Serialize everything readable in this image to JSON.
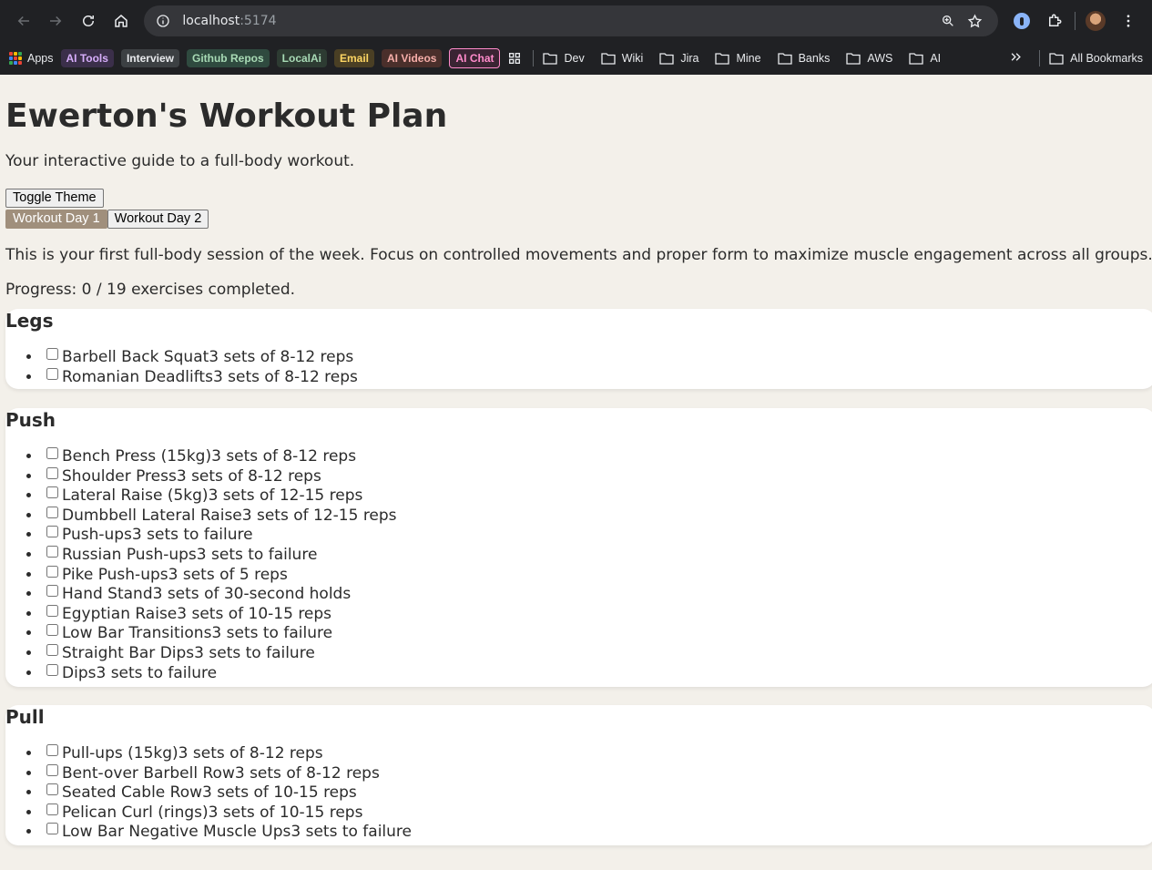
{
  "browser": {
    "url_host": "localhost",
    "url_port": ":5174",
    "bookmarks_pills": [
      {
        "label": "Apps",
        "color": "#e8eaed",
        "bg": "transparent"
      },
      {
        "label": "AI Tools",
        "color": "#d7aefb",
        "bg": "#3b2f4a"
      },
      {
        "label": "Interview",
        "color": "#e8eaed",
        "bg": "#3c4043"
      },
      {
        "label": "Github Repos",
        "color": "#a8dab5",
        "bg": "#2f4a3f"
      },
      {
        "label": "LocalAi",
        "color": "#a8dab5",
        "bg": "#2d3b32"
      },
      {
        "label": "Email",
        "color": "#fdd663",
        "bg": "#4a3f24"
      },
      {
        "label": "AI Videos",
        "color": "#f6aea9",
        "bg": "#4a2f2b"
      },
      {
        "label": "AI Chat",
        "color": "#ff8bcb",
        "bg": "#3a2433"
      }
    ],
    "bookmark_folders": [
      "Dev",
      "Wiki",
      "Jira",
      "Mine",
      "Banks",
      "AWS",
      "AI"
    ],
    "all_bookmarks": "All Bookmarks"
  },
  "page": {
    "title": "Ewerton's Workout Plan",
    "subtitle": "Your interactive guide to a full-body workout.",
    "toggle_theme": "Toggle Theme",
    "tabs": [
      "Workout Day 1",
      "Workout Day 2"
    ],
    "active_tab": "Workout Day 1",
    "accent_color": "#a08f7c",
    "description": "This is your first full-body session of the week. Focus on controlled movements and proper form to maximize muscle engagement across all groups.",
    "progress": "Progress: 0 / 19 exercises completed."
  },
  "groups": [
    {
      "name": "Legs",
      "exercises": [
        {
          "name": "Barbell Back Squat",
          "detail": "3 sets of 8-12 reps",
          "checked": false
        },
        {
          "name": "Romanian Deadlifts",
          "detail": "3 sets of 8-12 reps",
          "checked": false
        }
      ]
    },
    {
      "name": "Push",
      "exercises": [
        {
          "name": "Bench Press (15kg)",
          "detail": "3 sets of 8-12 reps",
          "checked": false
        },
        {
          "name": "Shoulder Press",
          "detail": "3 sets of 8-12 reps",
          "checked": false
        },
        {
          "name": "Lateral Raise (5kg)",
          "detail": "3 sets of 12-15 reps",
          "checked": false
        },
        {
          "name": "Dumbbell Lateral Raise",
          "detail": "3 sets of 12-15 reps",
          "checked": false
        },
        {
          "name": "Push-ups",
          "detail": "3 sets to failure",
          "checked": false
        },
        {
          "name": "Russian Push-ups",
          "detail": "3 sets to failure",
          "checked": false
        },
        {
          "name": "Pike Push-ups",
          "detail": "3 sets of 5 reps",
          "checked": false
        },
        {
          "name": "Hand Stand",
          "detail": "3 sets of 30-second holds",
          "checked": false
        },
        {
          "name": "Egyptian Raise",
          "detail": "3 sets of 10-15 reps",
          "checked": false
        },
        {
          "name": "Low Bar Transitions",
          "detail": "3 sets to failure",
          "checked": false
        },
        {
          "name": "Straight Bar Dips",
          "detail": "3 sets to failure",
          "checked": false
        },
        {
          "name": "Dips",
          "detail": "3 sets to failure",
          "checked": false
        }
      ]
    },
    {
      "name": "Pull",
      "exercises": [
        {
          "name": "Pull-ups (15kg)",
          "detail": "3 sets of 8-12 reps",
          "checked": false
        },
        {
          "name": "Bent-over Barbell Row",
          "detail": "3 sets of 8-12 reps",
          "checked": false
        },
        {
          "name": "Seated Cable Row",
          "detail": "3 sets of 10-15 reps",
          "checked": false
        },
        {
          "name": "Pelican Curl (rings)",
          "detail": "3 sets of 10-15 reps",
          "checked": false
        },
        {
          "name": "Low Bar Negative Muscle Ups",
          "detail": "3 sets to failure",
          "checked": false
        }
      ]
    }
  ]
}
